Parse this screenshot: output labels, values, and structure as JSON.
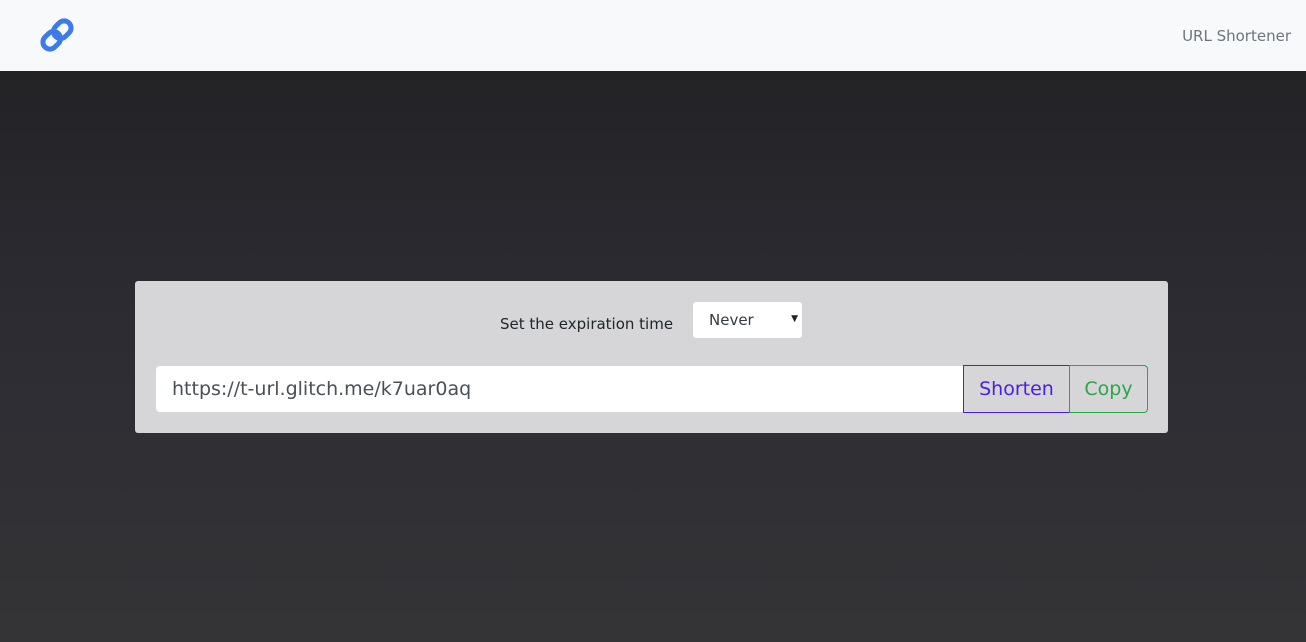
{
  "navbar": {
    "brand_icon": "link-icon",
    "nav_link_label": "URL Shortener"
  },
  "form": {
    "expiration_label": "Set the expiration time",
    "expiration_selected": "Never",
    "url_value": "https://t-url.glitch.me/k7uar0aq",
    "shorten_label": "Shorten",
    "copy_label": "Copy"
  },
  "colors": {
    "brand_blue": "#3d7be8",
    "shorten_purple": "#4b1ee0",
    "copy_green": "#28a745",
    "card_bg": "#d6d6d8",
    "navbar_bg": "#f8f9fa",
    "page_bg_dark": "#2a2a2f"
  }
}
